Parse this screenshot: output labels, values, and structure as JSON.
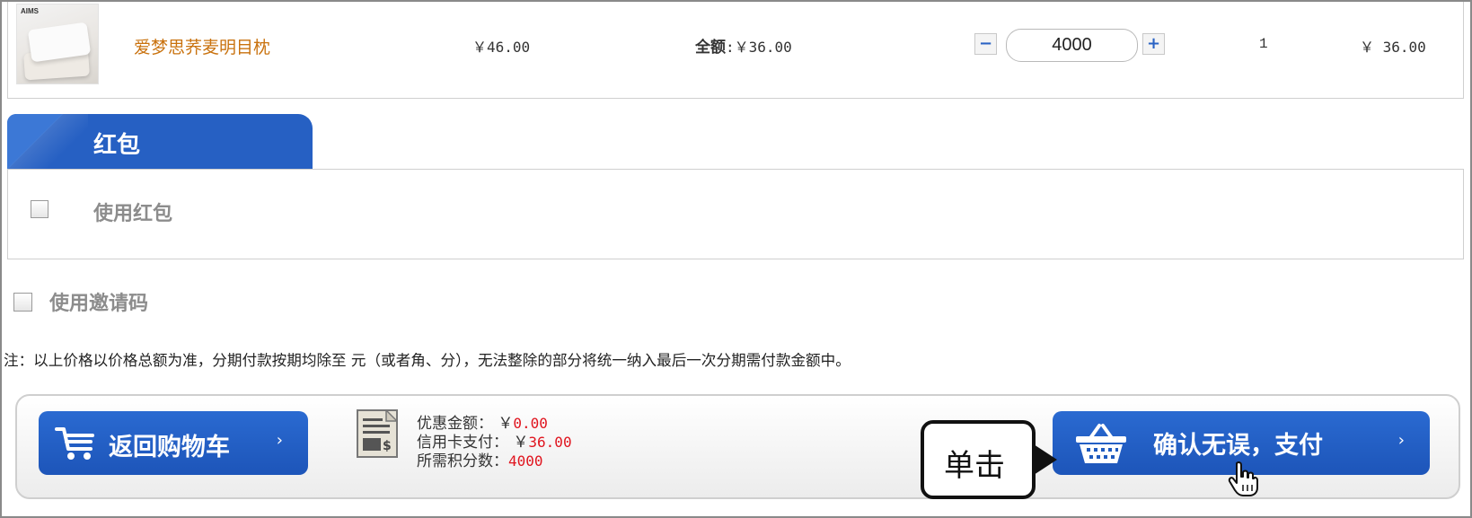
{
  "product": {
    "thumb_brand": "AIMS",
    "name": "爱梦思荞麦明目枕",
    "price": "￥46.00",
    "total_label": "全额",
    "total_value": ":￥36.00",
    "quantity": "4000",
    "minus_label": "−",
    "plus_label": "+",
    "points": "1",
    "subtotal": "￥ 36.00"
  },
  "hongbao": {
    "tab_title": "红包",
    "use_label": "使用红包",
    "checked": false
  },
  "invite": {
    "use_label": "使用邀请码",
    "checked": false
  },
  "note": "注：以上价格以价格总额为准，分期付款按期均除至 元（或者角、分），无法整除的部分将统一纳入最后一次分期需付款金额中。",
  "summary": {
    "discount_label": "优惠金额：  ￥",
    "discount_value": "0.00",
    "card_label": "信用卡支付：  ￥",
    "card_value": "36.00",
    "points_label": "所需积分数：",
    "points_value": "4000"
  },
  "buttons": {
    "back_cart": "返回购物车",
    "confirm_pay": "确认无误，支付",
    "arrow": "›"
  },
  "callout": {
    "text": "单击"
  },
  "colors": {
    "brand_blue": "#2660c3",
    "product_name": "#c9720e",
    "red_value": "#e0141e"
  },
  "icons": [
    "cart-icon",
    "receipt-icon",
    "basket-icon",
    "hand-pointer-icon",
    "checkbox"
  ]
}
